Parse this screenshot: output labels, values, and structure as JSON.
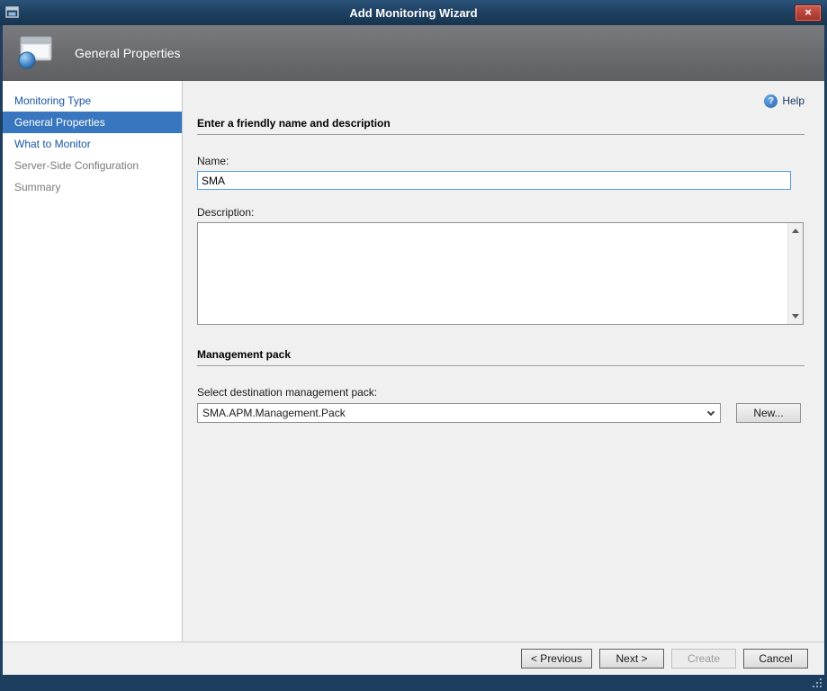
{
  "window": {
    "title": "Add Monitoring Wizard",
    "icons": {
      "close": "×",
      "help": "?"
    }
  },
  "header": {
    "title": "General Properties"
  },
  "sidebar": {
    "items": [
      {
        "label": "Monitoring Type",
        "state": "link"
      },
      {
        "label": "General Properties",
        "state": "current"
      },
      {
        "label": "What to Monitor",
        "state": "link"
      },
      {
        "label": "Server-Side Configuration",
        "state": "disabled"
      },
      {
        "label": "Summary",
        "state": "disabled"
      }
    ]
  },
  "main": {
    "help_label": "Help",
    "friendly_name_section": {
      "title": "Enter a friendly name and description",
      "name_label": "Name:",
      "name_value": "SMA",
      "description_label": "Description:",
      "description_value": ""
    },
    "management_pack_section": {
      "title": "Management pack",
      "select_label": "Select destination management pack:",
      "selected_pack": "SMA.APM.Management.Pack",
      "new_button_label": "New..."
    }
  },
  "footer": {
    "previous_label": "< Previous",
    "next_label": "Next >",
    "create_label": "Create",
    "cancel_label": "Cancel"
  },
  "colors": {
    "window_chrome": "#1d3e5f",
    "header_band": "#6a6c6f",
    "active_step_bg": "#3876bf",
    "step_link_text": "#1a56a0",
    "focused_input_border": "#569de5",
    "close_button_red": "#b03a31",
    "help_icon_blue": "#2a62ae",
    "content_background": "#f0f0f0"
  }
}
